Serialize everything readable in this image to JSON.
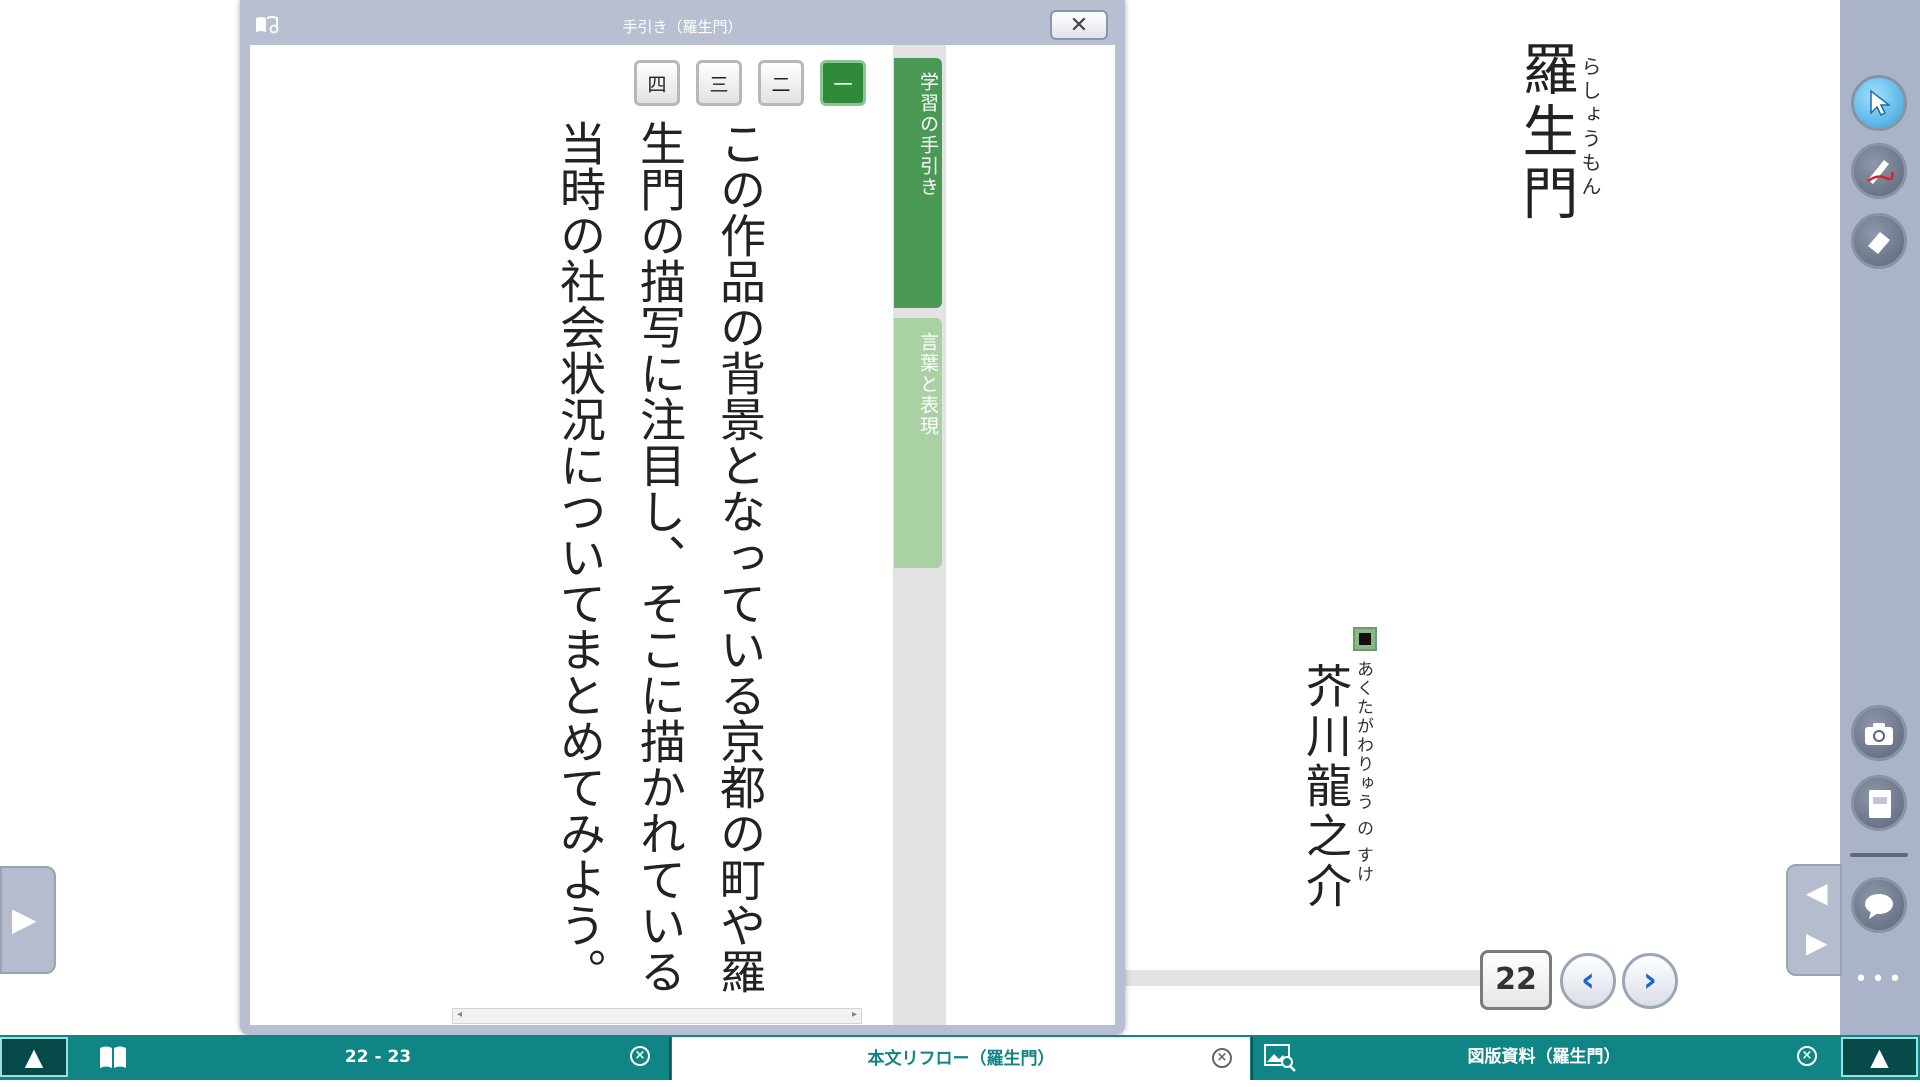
{
  "right_page": {
    "title": "羅生門",
    "title_ruby": "らしょうもん",
    "author": "芥川龍之介",
    "author_ruby": "あくたがわりゅう の すけ",
    "page_number": "22"
  },
  "guide": {
    "window_title": "手引き（羅生門）",
    "close_label": "✕",
    "question_tabs": [
      "四",
      "三",
      "二",
      "一"
    ],
    "active_question": "一",
    "question_text": "この作品の背景となっている京都の町や羅生門の描写に注目し、そこに描かれている当時の社会状況についてまとめてみよう。",
    "side_tabs": {
      "guide": "学習の手引き",
      "words": "言葉と表現"
    }
  },
  "taskbar": {
    "tab1_label": "22 - 23",
    "tab2_label": "本文リフロー（羅生門）",
    "tab3_label": "図版資料（羅生門）"
  },
  "icons": {
    "up": "▲",
    "prev": "‹",
    "next": "›",
    "left_tab": "▶",
    "side_prev": "◀",
    "side_next": "▶",
    "more": "•••",
    "close_small": "×"
  },
  "colors": {
    "taskbar": "#0f8585",
    "active_green": "#2f8a3a",
    "toolbar": "#aab3c7",
    "nav_blue": "#1a66d6"
  }
}
